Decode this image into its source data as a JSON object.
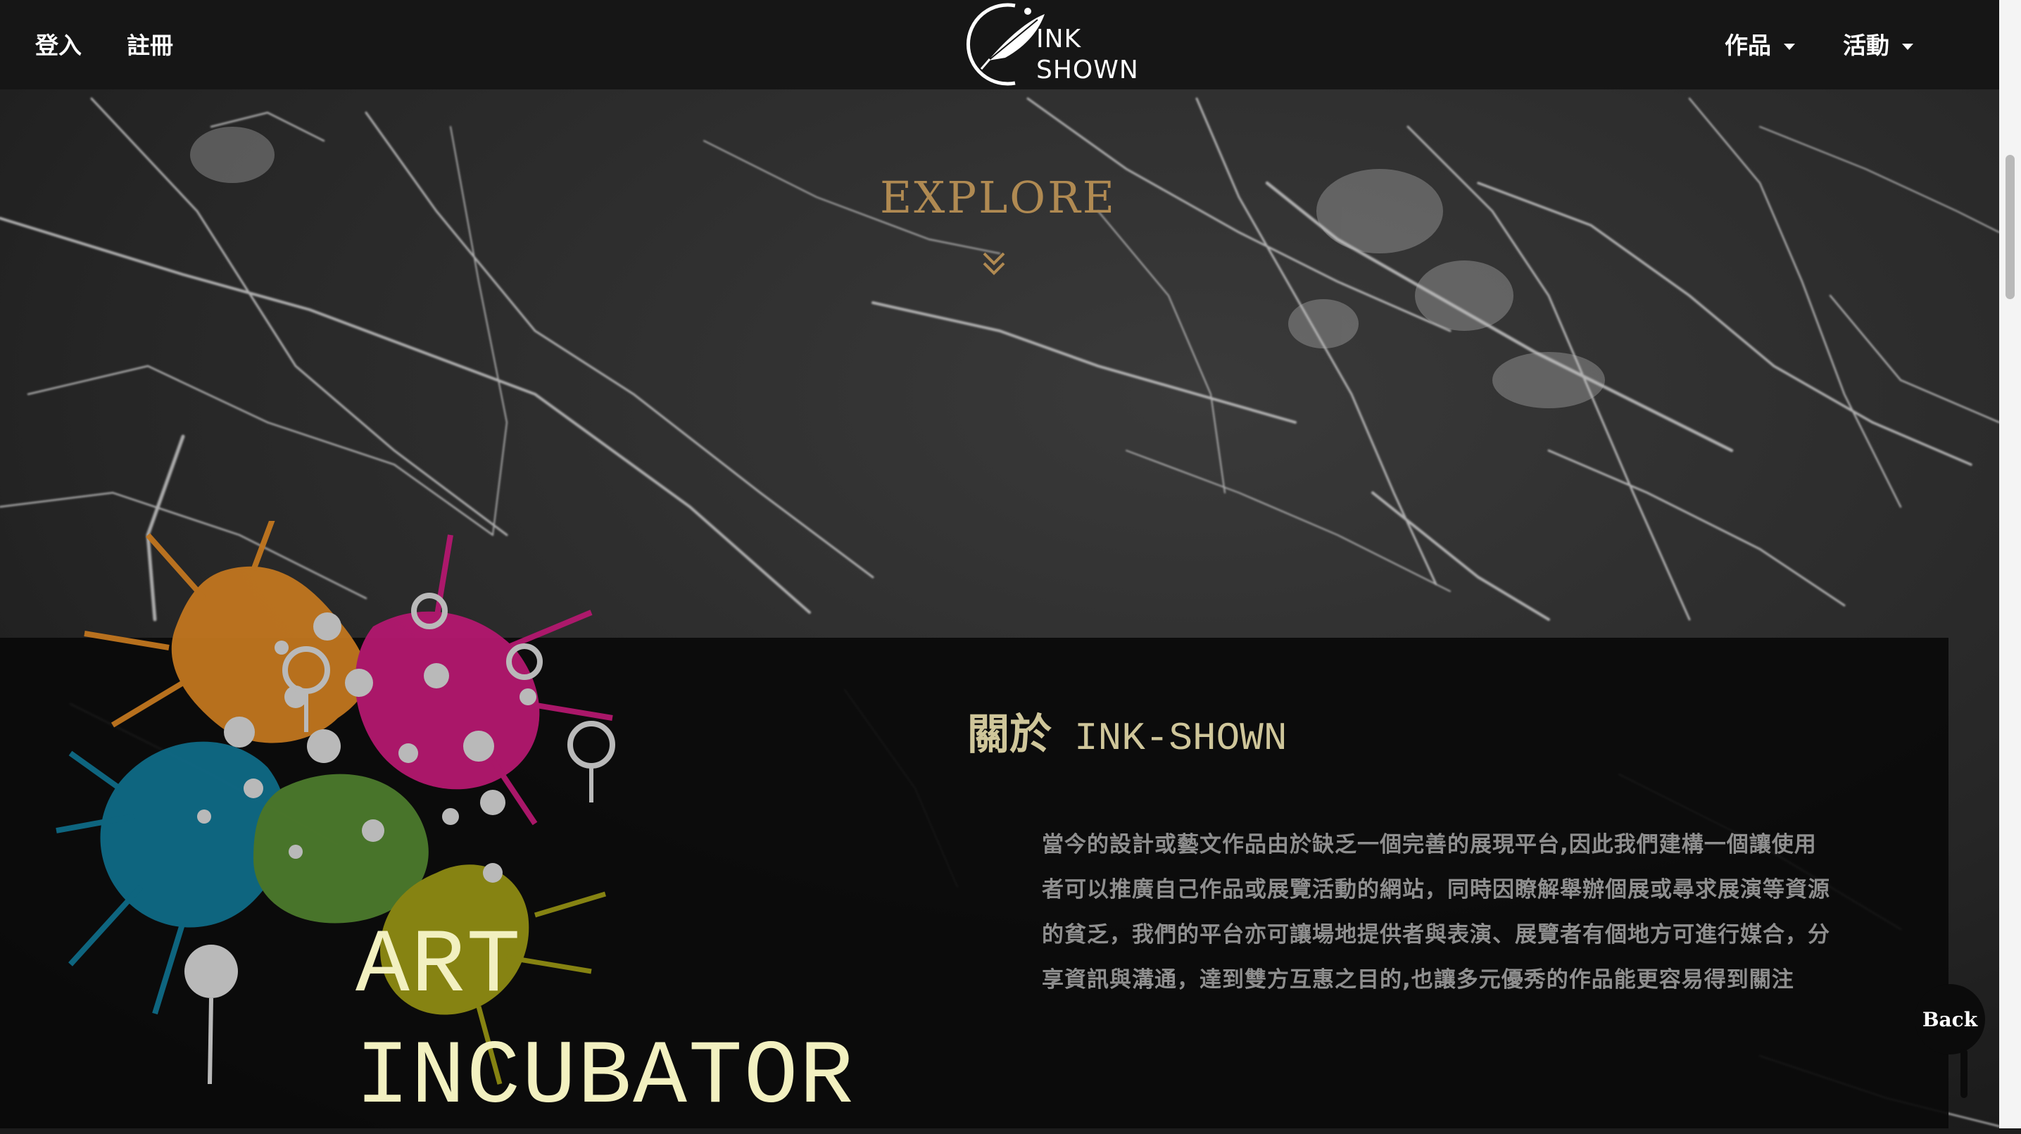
{
  "nav": {
    "login": "登入",
    "register": "註冊",
    "works": "作品",
    "events": "活動"
  },
  "logo": {
    "line1": "INK",
    "line2": "SHOWN"
  },
  "hero": {
    "explore": "EXPLORE"
  },
  "about": {
    "heading_zh": "關於",
    "heading_en": "INK-SHOWN",
    "paragraph": "當今的設計或藝文作品由於缺乏一個完善的展現平台,因此我們建構一個讓使用者可以推廣自己作品或展覽活動的網站，同時因瞭解舉辦個展或尋求展演等資源的貧乏，我們的平台亦可讓場地提供者與表演、展覽者有個地方可進行媒合，分享資訊與溝通，達到雙方互惠之目的,也讓多元優秀的作品能更容易得到關注"
  },
  "art_title": {
    "line1": "ART",
    "line2": "INCUBATOR"
  },
  "back_button": "Back",
  "colors": {
    "navbar": "#161616",
    "explore": "#b08a52",
    "heading": "#cfc69a",
    "art_title": "#f2f0c0",
    "paint_orange": "#c1761f",
    "paint_magenta": "#b3186f",
    "paint_teal": "#0f6a86",
    "paint_green": "#4c7a2c",
    "paint_olive": "#8d8a13"
  },
  "icons": {
    "logo": "feather-quill-icon",
    "explore": "double-chevron-down-icon",
    "dropdown": "caret-down-icon"
  }
}
